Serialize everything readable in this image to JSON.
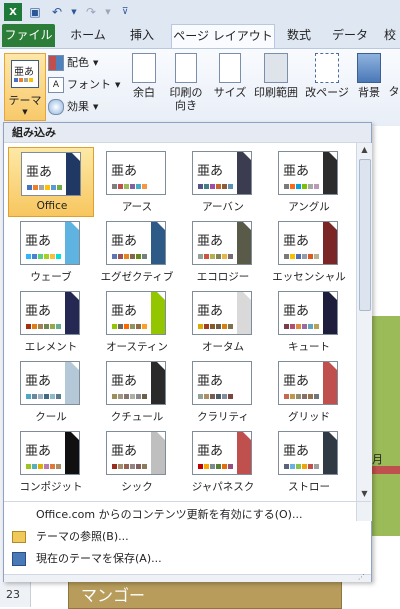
{
  "qat": {
    "excel_icon": "excel-icon",
    "save_icon": "save-icon",
    "undo_icon": "undo-icon",
    "redo_icon": "redo-icon"
  },
  "tabs": [
    {
      "label": "ファイル"
    },
    {
      "label": "ホーム"
    },
    {
      "label": "挿入"
    },
    {
      "label": "ページ レイアウト"
    },
    {
      "label": "数式"
    },
    {
      "label": "データ"
    },
    {
      "label": "校"
    }
  ],
  "ribbon": {
    "themes_label": "テーマ",
    "colors_label": "配色",
    "fonts_label": "フォント",
    "effects_label": "効果",
    "margins_label": "余白",
    "orientation_label": "印刷の\n向き",
    "size_label": "サイズ",
    "print_area_label": "印刷範囲",
    "breaks_label": "改ページ",
    "background_label": "背景",
    "print_titles_label": "タ"
  },
  "gallery": {
    "header": "組み込み",
    "themes": [
      {
        "name": "Office",
        "sample": "亜あ",
        "accent": "#1f3864",
        "swatches": [
          "#4472c4",
          "#ed7d31",
          "#a5a5a5",
          "#ffc000",
          "#5b9bd5",
          "#70ad47"
        ],
        "selected": true
      },
      {
        "name": "アース",
        "sample": "亜あ",
        "accent": "#ffffff",
        "swatches": [
          "#7f7f7f",
          "#c0504d",
          "#9bbb59",
          "#8064a2",
          "#4bacc6",
          "#f79646"
        ]
      },
      {
        "name": "アーバン",
        "sample": "亜あ",
        "accent": "#3c3c50",
        "swatches": [
          "#53548a",
          "#438086",
          "#a04da3",
          "#c4652d",
          "#8b5d3d",
          "#5c92b5"
        ]
      },
      {
        "name": "アングル",
        "sample": "亜あ",
        "accent": "#2c2c2c",
        "swatches": [
          "#797b7e",
          "#f96a1b",
          "#08a1d9",
          "#7cc200",
          "#a8a8a8",
          "#bb9ab7"
        ]
      },
      {
        "name": "ウェーブ",
        "sample": "亜あ",
        "accent": "#5fb3e0",
        "swatches": [
          "#31b6fd",
          "#4584d3",
          "#5bd078",
          "#a5d028",
          "#f5c040",
          "#05e0db"
        ]
      },
      {
        "name": "エグゼクティブ",
        "sample": "亜あ",
        "accent": "#2e5a88",
        "swatches": [
          "#6076b4",
          "#9c5252",
          "#e68422",
          "#846648",
          "#63891f",
          "#758085"
        ]
      },
      {
        "name": "エコロジー",
        "sample": "亜あ",
        "accent": "#5a5a48",
        "swatches": [
          "#93a299",
          "#cf543f",
          "#b5ae53",
          "#848058",
          "#e8b54d",
          "#786c71"
        ]
      },
      {
        "name": "エッセンシャル",
        "sample": "亜あ",
        "accent": "#7b2626",
        "swatches": [
          "#7a7a7a",
          "#f5c201",
          "#526db0",
          "#989aac",
          "#dc5924",
          "#b4b392"
        ]
      },
      {
        "name": "エレメント",
        "sample": "亜あ",
        "accent": "#242852",
        "swatches": [
          "#a53010",
          "#de7e18",
          "#9f8351",
          "#728653",
          "#92aa4c",
          "#6aac91"
        ]
      },
      {
        "name": "オースティン",
        "sample": "亜あ",
        "accent": "#94c600",
        "swatches": [
          "#94c600",
          "#71685a",
          "#ff6700",
          "#909465",
          "#956b43",
          "#fea022"
        ]
      },
      {
        "name": "オータム",
        "sample": "亜あ",
        "accent": "#d9d9d9",
        "swatches": [
          "#dea900",
          "#a23b20",
          "#845b2c",
          "#6e5d45",
          "#d67f11",
          "#7b714f"
        ]
      },
      {
        "name": "キュート",
        "sample": "亜あ",
        "accent": "#1e1e3c",
        "swatches": [
          "#7d3c4a",
          "#b04f6e",
          "#df8b40",
          "#9b6ba2",
          "#63a4ba",
          "#b7a357"
        ]
      },
      {
        "name": "クール",
        "sample": "亜あ",
        "accent": "#b4c8d8",
        "swatches": [
          "#4fa7c6",
          "#6a8a9c",
          "#9ab0be",
          "#3e6a85",
          "#8fb9c9",
          "#587a8c"
        ]
      },
      {
        "name": "クチュール",
        "sample": "亜あ",
        "accent": "#2a2a2a",
        "swatches": [
          "#9e8e5c",
          "#a09781",
          "#85776d",
          "#aeafa9",
          "#8d878b",
          "#6b6149"
        ]
      },
      {
        "name": "クラリティ",
        "sample": "亜あ",
        "accent": "#ffffff",
        "swatches": [
          "#93a299",
          "#ad8f67",
          "#726056",
          "#4c5a6a",
          "#808da0",
          "#79463d"
        ]
      },
      {
        "name": "グリッド",
        "sample": "亜あ",
        "accent": "#c0504d",
        "swatches": [
          "#c66951",
          "#bf974d",
          "#928b70",
          "#87706b",
          "#94734e",
          "#6f777d"
        ]
      },
      {
        "name": "コンポジット",
        "sample": "亜あ",
        "accent": "#101010",
        "swatches": [
          "#98c723",
          "#59b0b9",
          "#deae00",
          "#b77bb4",
          "#e0773c",
          "#a98d63"
        ]
      },
      {
        "name": "シック",
        "sample": "亜あ",
        "accent": "#bfbfbf",
        "swatches": [
          "#9b2d1f",
          "#a28e6a",
          "#956251",
          "#918485",
          "#855d5d",
          "#8e7a5c"
        ]
      },
      {
        "name": "ジャパネスク",
        "sample": "亜あ",
        "accent": "#c0504d",
        "swatches": [
          "#c00000",
          "#f9a602",
          "#7a8c8e",
          "#5a7d3b",
          "#e46c0a",
          "#974d7f"
        ]
      },
      {
        "name": "ストロー",
        "sample": "亜あ",
        "accent": "#2f3a44",
        "swatches": [
          "#5a6378",
          "#6ab1e0",
          "#8bc34a",
          "#f0a30a",
          "#c0504d",
          "#9e9e9e"
        ]
      }
    ]
  },
  "commands": [
    {
      "label": "Office.com からのコンテンツ更新を有効にする(O)...",
      "icon": "office-icon"
    },
    {
      "label": "テーマの参照(B)...",
      "icon": "browse-folder-icon"
    },
    {
      "label": "現在のテーマを保存(A)...",
      "icon": "save-theme-icon"
    }
  ],
  "sheet": {
    "row_numbers": [
      "23"
    ],
    "cell_text": "マンゴー",
    "chart_text": "月"
  }
}
